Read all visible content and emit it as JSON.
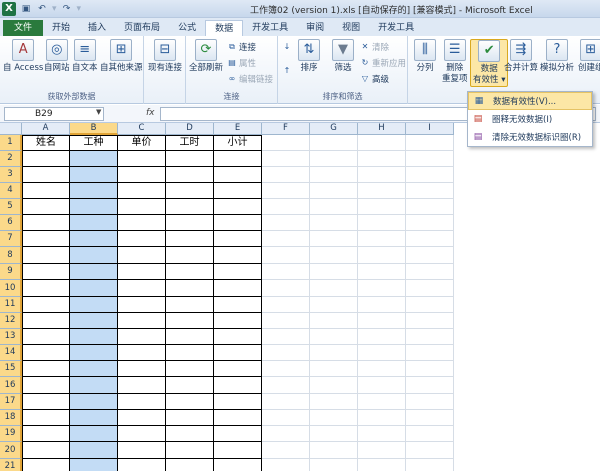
{
  "window": {
    "title": "工作簿02 (version 1).xls [自动保存的] [兼容模式] - Microsoft Excel"
  },
  "tabs": [
    "文件",
    "开始",
    "插入",
    "页面布局",
    "公式",
    "数据",
    "开发工具",
    "审阅",
    "视图",
    "开发工具"
  ],
  "ribbon": {
    "groups": {
      "external_data": "获取外部数据",
      "connections": "连接",
      "sort_filter": "排序和筛选"
    },
    "buttons": {
      "from_access": "自 Access",
      "from_web": "自网站",
      "from_text": "自文本",
      "from_other": "自其他来源",
      "existing_conn": "现有连接",
      "refresh_all": "全部刷新",
      "connections": "连接",
      "properties": "属性",
      "edit_links": "编辑链接",
      "sort": "排序",
      "filter": "筛选",
      "clear": "清除",
      "reapply": "重新应用",
      "advanced": "高级",
      "text_to_columns": "分列",
      "remove_dup_1": "删除",
      "remove_dup_2": "重复项",
      "data_validation_1": "数据",
      "data_validation_2": "有效性",
      "consolidate": "合并计算",
      "whatif": "模拟分析",
      "create": "创建组"
    }
  },
  "menu": {
    "items": [
      "数据有效性(V)...",
      "圈释无效数据(I)",
      "清除无效数据标识圈(R)"
    ]
  },
  "formula_bar": {
    "name_box": "B29",
    "fx": "fx"
  },
  "sheet": {
    "columns": [
      "A",
      "B",
      "C",
      "D",
      "E",
      "F",
      "G",
      "H",
      "I"
    ],
    "rows": [
      "1",
      "2",
      "3",
      "4",
      "5",
      "6",
      "7",
      "8",
      "9",
      "10",
      "11",
      "12",
      "13",
      "14",
      "15",
      "16",
      "17",
      "18",
      "19",
      "20",
      "21"
    ],
    "headers": [
      "姓名",
      "工种",
      "单价",
      "工时",
      "小计"
    ]
  }
}
